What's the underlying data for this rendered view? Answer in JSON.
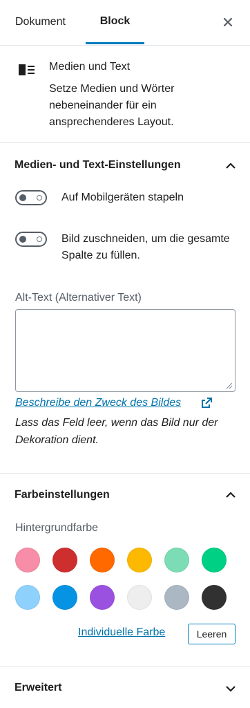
{
  "tabs": {
    "document": "Dokument",
    "block": "Block",
    "close_icon": "close-icon"
  },
  "block_card": {
    "icon": "media-text-icon",
    "title": "Medien und Text",
    "description": "Setze Medien und Wörter nebeneinander für ein ansprechenderes Layout."
  },
  "media_settings": {
    "title": "Medien- und Text-Einstellungen",
    "expanded": true,
    "toggle_stack": {
      "label": "Auf Mobilgeräten stapeln",
      "checked": false
    },
    "toggle_crop": {
      "label": "Bild zuschneiden, um die gesamte Spalte zu füllen.",
      "checked": false
    },
    "alt_label": "Alt-Text (Alternativer Text)",
    "alt_value": "",
    "alt_link": "Beschreibe den Zweck des Bildes",
    "alt_help": "Lass das Feld leer, wenn das Bild nur der Dekoration dient."
  },
  "color_settings": {
    "title": "Farbeinstellungen",
    "expanded": true,
    "background_label": "Hintergrundfarbe",
    "palette": [
      "#f78da7",
      "#cf2e2e",
      "#ff6900",
      "#fcb900",
      "#7bdcb5",
      "#00d084",
      "#8ed1fc",
      "#0693e3",
      "#9b51e0",
      "#eeeeee",
      "#abb8c3",
      "#313131"
    ],
    "custom_color": "Individuelle Farbe",
    "clear": "Leeren"
  },
  "advanced": {
    "title": "Erweitert",
    "expanded": false
  }
}
